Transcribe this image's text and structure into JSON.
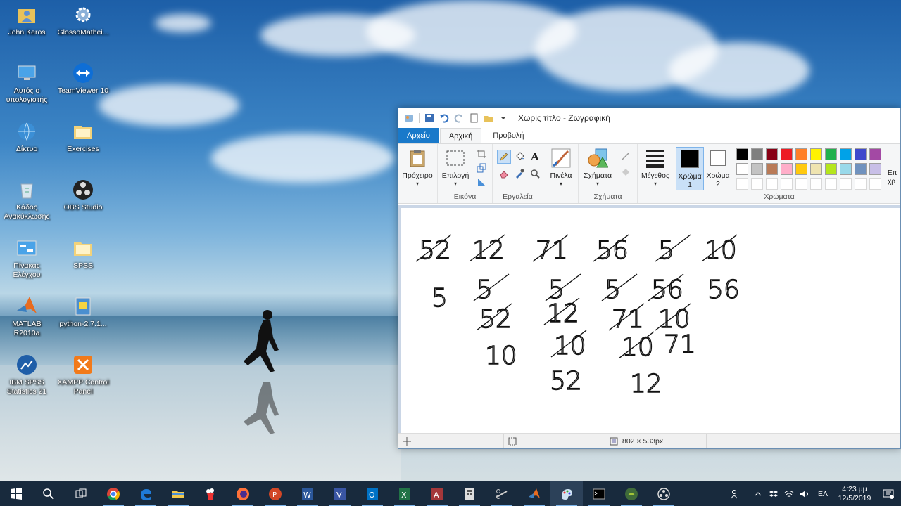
{
  "desktop": {
    "icons": [
      {
        "label": "John Keros",
        "icon": "user-folder-icon"
      },
      {
        "label": "GlossoMathei...",
        "icon": "gear-icon"
      },
      {
        "label": "Αυτός ο υπολογιστής",
        "icon": "computer-icon"
      },
      {
        "label": "TeamViewer 10",
        "icon": "teamviewer-icon"
      },
      {
        "label": "Δίκτυο",
        "icon": "network-icon"
      },
      {
        "label": "Exercises",
        "icon": "folder-icon"
      },
      {
        "label": "Κάδος Ανακύκλωσης",
        "icon": "recycle-bin-icon"
      },
      {
        "label": "OBS Studio",
        "icon": "obs-icon"
      },
      {
        "label": "Πίνακας Ελέγχου",
        "icon": "control-panel-icon"
      },
      {
        "label": "SPSS",
        "icon": "folder-icon"
      },
      {
        "label": "MATLAB R2010a",
        "icon": "matlab-icon"
      },
      {
        "label": "python-2.7.1...",
        "icon": "python-installer-icon"
      },
      {
        "label": "IBM SPSS Statistics 21",
        "icon": "spss-icon"
      },
      {
        "label": "XAMPP Control Panel",
        "icon": "xampp-icon"
      }
    ]
  },
  "paint": {
    "title": "Χωρίς τίτλο - Ζωγραφική",
    "tabs": [
      "Αρχείο",
      "Αρχική",
      "Προβολή"
    ],
    "ribbon": {
      "clipboard": "Πρόχειρο",
      "select": "Επιλογή",
      "image_group": "Εικόνα",
      "tools_group": "Εργαλεία",
      "brushes": "Πινέλα",
      "shapes": "Σχήματα",
      "shapes_group": "Σχήματα",
      "size": "Μέγεθος",
      "color1": "Χρώμα 1",
      "color2": "Χρώμα 2",
      "colors_group": "Χρώματα",
      "edit_colors": "Επ χρ"
    },
    "palette": [
      "#000000",
      "#7f7f7f",
      "#880015",
      "#ed1c24",
      "#ff7f27",
      "#fff200",
      "#22b14c",
      "#00a2e8",
      "#3f48cc",
      "#a349a4",
      "#ffffff",
      "#c3c3c3",
      "#b97a57",
      "#ffaec9",
      "#ffc90e",
      "#efe4b0",
      "#b5e61d",
      "#99d9ea",
      "#7092be",
      "#c8bfe7",
      "#ffffff",
      "#ffffff",
      "#ffffff",
      "#ffffff",
      "#ffffff",
      "#ffffff",
      "#ffffff",
      "#ffffff",
      "#ffffff",
      "#ffffff"
    ],
    "canvas_numbers": [
      {
        "text": "52",
        "crossed": true
      },
      {
        "text": "12",
        "crossed": true
      },
      {
        "text": "71",
        "crossed": true
      },
      {
        "text": "56",
        "crossed": true
      },
      {
        "text": "5",
        "crossed": true
      },
      {
        "text": "10",
        "crossed": true
      },
      {
        "text": "5",
        "crossed": false
      },
      {
        "text": "5",
        "crossed": true
      },
      {
        "text": "5",
        "crossed": true
      },
      {
        "text": "5",
        "crossed": true
      },
      {
        "text": "56",
        "crossed": true
      },
      {
        "text": "56",
        "crossed": false
      },
      {
        "text": "52",
        "crossed": true
      },
      {
        "text": "12",
        "crossed": true
      },
      {
        "text": "71",
        "crossed": true
      },
      {
        "text": "10",
        "crossed": true
      },
      {
        "text": "10",
        "crossed": false
      },
      {
        "text": "10",
        "crossed": true
      },
      {
        "text": "10",
        "crossed": true
      },
      {
        "text": "71",
        "crossed": false
      },
      {
        "text": "52",
        "crossed": false
      },
      {
        "text": "12",
        "crossed": false
      }
    ],
    "status": {
      "dimensions": "802 × 533px"
    }
  },
  "taskbar": {
    "apps": [
      "start-icon",
      "search-icon",
      "task-view-icon",
      "chrome-icon",
      "edge-icon",
      "file-explorer-icon",
      "popcorn-icon",
      "firefox-icon",
      "powerpoint-icon",
      "word-icon",
      "visio-icon",
      "outlook-icon",
      "excel-icon",
      "access-icon",
      "calculator-icon",
      "snipping-icon",
      "matlab-icon",
      "paint-icon",
      "cmd-icon",
      "android-icon",
      "obs-icon"
    ],
    "tray": {
      "language": "ΕΛ",
      "time": "4:23 μμ",
      "date": "12/5/2019"
    }
  }
}
